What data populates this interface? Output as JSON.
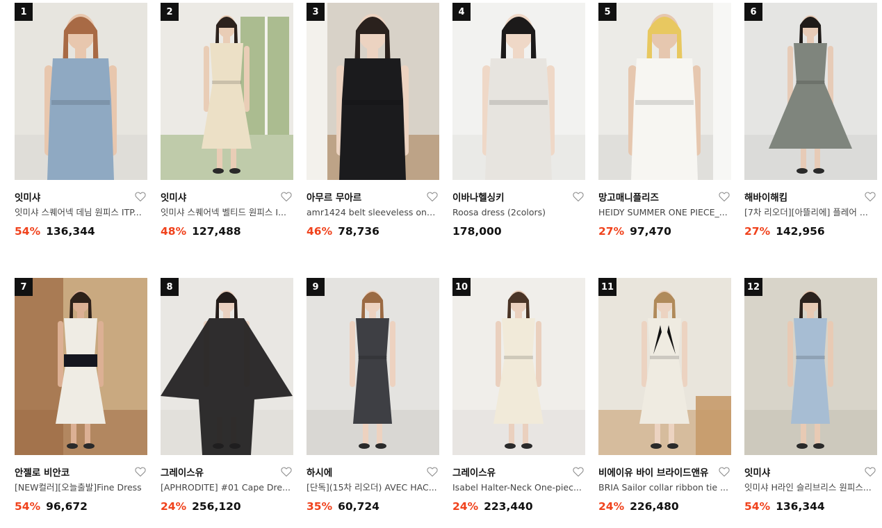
{
  "colors": {
    "discount": "#f0421c",
    "rank_badge": "#111111"
  },
  "products": [
    {
      "rank": "1",
      "brand": "잇미샤",
      "name": "잇미샤 스퀘어넥 데님 원피스 ITP...",
      "discount": "54%",
      "price": "136,344",
      "photo": {
        "bg": "#e7e5df",
        "bg2": "#d9d7d1",
        "dress": "#8fa9c2",
        "skin": "#e8c7ae",
        "hair": "#a86a45",
        "style": "denim"
      }
    },
    {
      "rank": "2",
      "brand": "잇미샤",
      "name": "잇미샤 스퀘어넥 벨티드 원피스 I...",
      "discount": "48%",
      "price": "127,488",
      "photo": {
        "bg": "#eceae5",
        "bg2": "#9bb07a",
        "dress": "#ece0c6",
        "skin": "#e9cdb6",
        "hair": "#2c221d",
        "style": "belted"
      }
    },
    {
      "rank": "3",
      "brand": "아무르 무아르",
      "name": "amr1424 belt sleeveless one...",
      "discount": "46%",
      "price": "78,736",
      "photo": {
        "bg": "#d8d2c8",
        "bg2": "#a77b52",
        "dress": "#1b1b1d",
        "skin": "#ecd3c1",
        "hair": "#2a211d",
        "style": "sleeveless"
      }
    },
    {
      "rank": "4",
      "brand": "이바나헬싱키",
      "name": "Roosa dress (2colors)",
      "discount": "",
      "price": "178,000",
      "photo": {
        "bg": "#f2f2f0",
        "bg2": "#e3e3e0",
        "dress": "#e7e4df",
        "skin": "#efd8c7",
        "hair": "#1c1a1a",
        "style": "fitted"
      }
    },
    {
      "rank": "5",
      "brand": "망고매니플리즈",
      "name": "HEIDY SUMMER ONE PIECE_...",
      "discount": "27%",
      "price": "97,470",
      "photo": {
        "bg": "#ecebe7",
        "bg2": "#d7d6d2",
        "dress": "#f7f6f2",
        "skin": "#e6c7af",
        "hair": "#e8c860",
        "style": "pleats"
      }
    },
    {
      "rank": "6",
      "brand": "해바이해킴",
      "name": "[7차 리오더][아뜰리에] 플레어 ...",
      "discount": "27%",
      "price": "142,956",
      "photo": {
        "bg": "#e5e5e3",
        "bg2": "#d4d4d1",
        "dress": "#7f857d",
        "skin": "#e7cbb7",
        "hair": "#1f1b19",
        "style": "flare"
      }
    },
    {
      "rank": "7",
      "brand": "안젤로 비안코",
      "name": "[NEW컬러][오늘출발]Fine Dress",
      "discount": "54%",
      "price": "96,672",
      "photo": {
        "bg": "#c9a980",
        "bg2": "#9e6c45",
        "dress": "#efece4",
        "skin": "#dcb094",
        "hair": "#2e211a",
        "style": "wrap"
      }
    },
    {
      "rank": "8",
      "brand": "그레이스유",
      "name": "[APHRODITE] #01 Cape Dre...",
      "discount": "24%",
      "price": "256,120",
      "photo": {
        "bg": "#e9e7e3",
        "bg2": "#dcdad6",
        "dress": "#1e1d1e",
        "skin": "#ead1c0",
        "hair": "#231c19",
        "style": "cape"
      }
    },
    {
      "rank": "9",
      "brand": "하시에",
      "name": "[단독](15차 리오더) AVEC HAC...",
      "discount": "35%",
      "price": "60,724",
      "photo": {
        "bg": "#e4e3e0",
        "bg2": "#cfcdc9",
        "dress": "#3e3f44",
        "skin": "#edd2c0",
        "hair": "#9b6a43",
        "style": "tshirt"
      }
    },
    {
      "rank": "10",
      "brand": "그레이스유",
      "name": "Isabel Halter-Neck One-piec...",
      "discount": "24%",
      "price": "223,440",
      "photo": {
        "bg": "#f0eeea",
        "bg2": "#e2dfda",
        "dress": "#f1ead9",
        "skin": "#ead0be",
        "hair": "#4a3426",
        "style": "halter"
      }
    },
    {
      "rank": "11",
      "brand": "비에이유 바이 브라이드앤유",
      "name": "BRIA Sailor collar ribbon tie ...",
      "discount": "24%",
      "price": "226,480",
      "photo": {
        "bg": "#e9e5dc",
        "bg2": "#c79a6a",
        "dress": "#efebe1",
        "skin": "#ecd3c1",
        "hair": "#b08a5a",
        "style": "sailor"
      }
    },
    {
      "rank": "12",
      "brand": "잇미샤",
      "name": "잇미샤 H라인 슬리브리스 원피스...",
      "discount": "54%",
      "price": "136,344",
      "photo": {
        "bg": "#d8d4c9",
        "bg2": "#c4bfb2",
        "dress": "#a7bdd3",
        "skin": "#e8cab4",
        "hair": "#2c221d",
        "style": "hline"
      }
    }
  ]
}
